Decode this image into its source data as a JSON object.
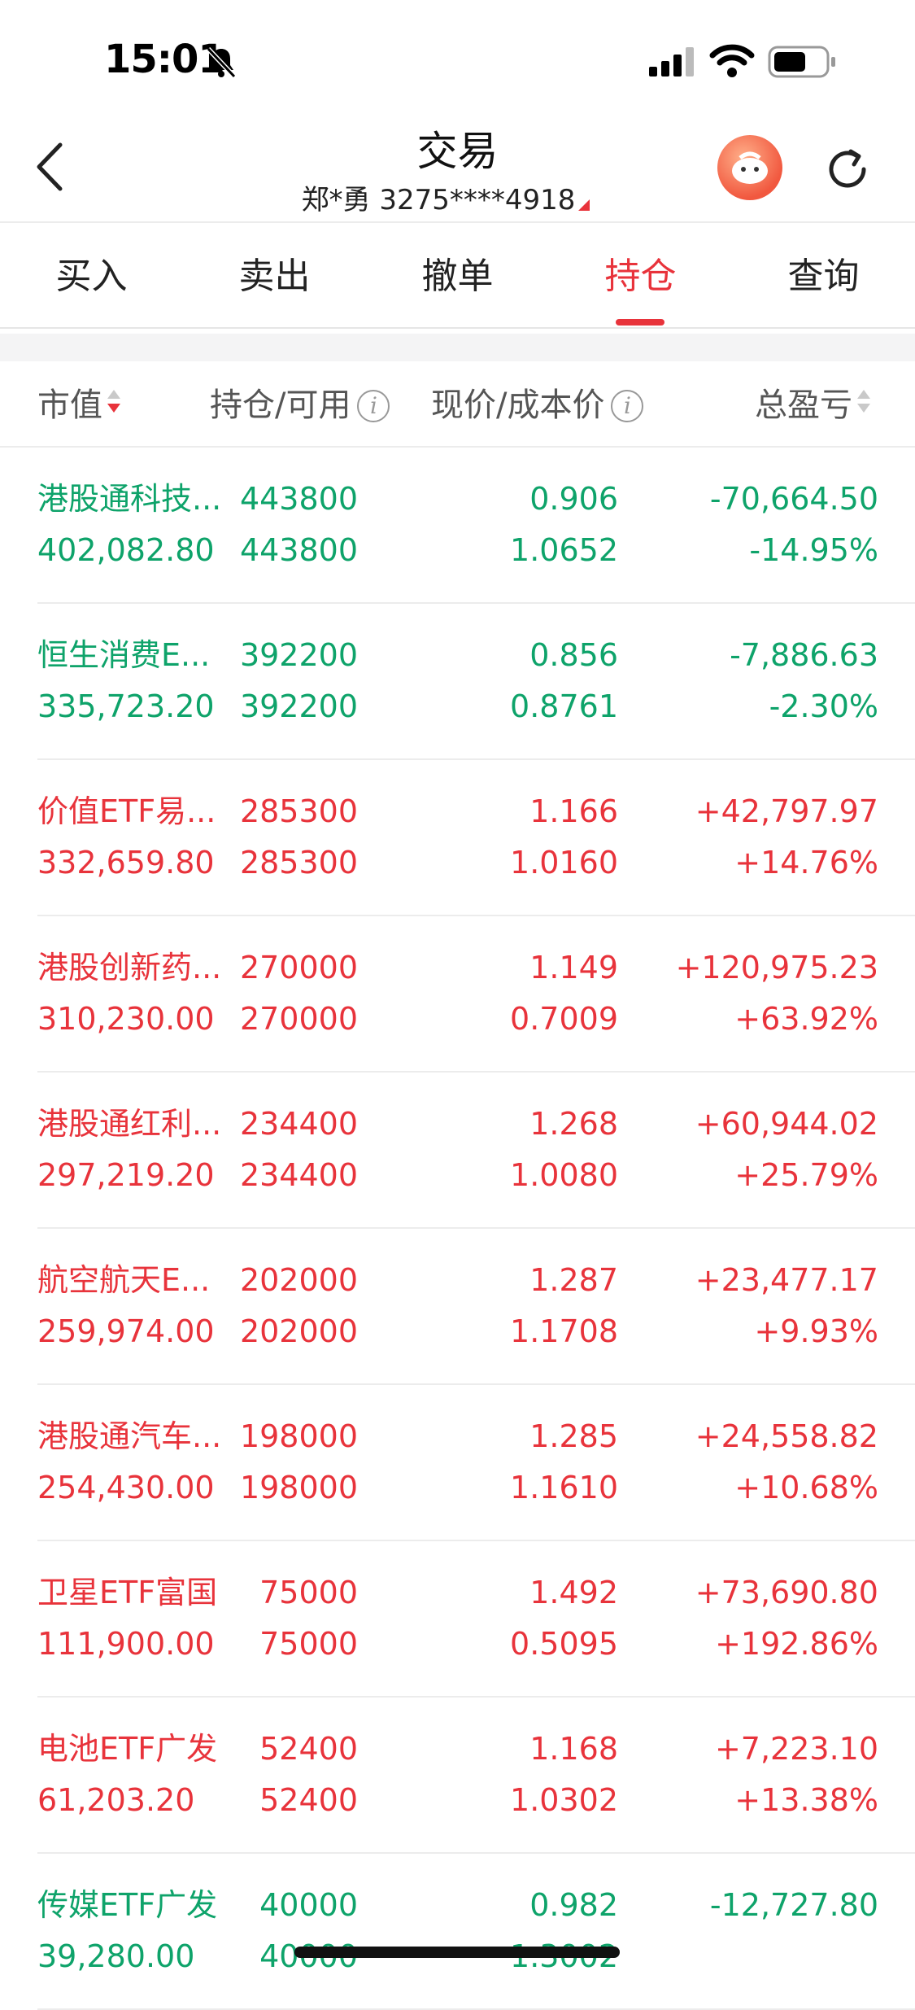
{
  "status_bar": {
    "time": "15:01"
  },
  "header": {
    "title": "交易",
    "account": "郑*勇 3275****4918"
  },
  "tabs": [
    {
      "label": "买入"
    },
    {
      "label": "卖出"
    },
    {
      "label": "撤单"
    },
    {
      "label": "持仓"
    },
    {
      "label": "查询"
    }
  ],
  "active_tab": "持仓",
  "columns": {
    "col1": "市值",
    "col2": "持仓/可用",
    "col3": "现价/成本价",
    "col4": "总盈亏"
  },
  "colors": {
    "up": "#e8333b",
    "down": "#0ea36a"
  },
  "holdings": [
    {
      "name": "港股通科技...",
      "market_value": "402,082.80",
      "position": "443800",
      "available": "443800",
      "price": "0.906",
      "cost": "1.0652",
      "pnl": "-70,664.50",
      "pnl_pct": "-14.95%",
      "trend": "dn"
    },
    {
      "name": "恒生消费E...",
      "market_value": "335,723.20",
      "position": "392200",
      "available": "392200",
      "price": "0.856",
      "cost": "0.8761",
      "pnl": "-7,886.63",
      "pnl_pct": "-2.30%",
      "trend": "dn"
    },
    {
      "name": "价值ETF易...",
      "market_value": "332,659.80",
      "position": "285300",
      "available": "285300",
      "price": "1.166",
      "cost": "1.0160",
      "pnl": "+42,797.97",
      "pnl_pct": "+14.76%",
      "trend": "up"
    },
    {
      "name": "港股创新药...",
      "market_value": "310,230.00",
      "position": "270000",
      "available": "270000",
      "price": "1.149",
      "cost": "0.7009",
      "pnl": "+120,975.23",
      "pnl_pct": "+63.92%",
      "trend": "up"
    },
    {
      "name": "港股通红利...",
      "market_value": "297,219.20",
      "position": "234400",
      "available": "234400",
      "price": "1.268",
      "cost": "1.0080",
      "pnl": "+60,944.02",
      "pnl_pct": "+25.79%",
      "trend": "up"
    },
    {
      "name": "航空航天E...",
      "market_value": "259,974.00",
      "position": "202000",
      "available": "202000",
      "price": "1.287",
      "cost": "1.1708",
      "pnl": "+23,477.17",
      "pnl_pct": "+9.93%",
      "trend": "up"
    },
    {
      "name": "港股通汽车...",
      "market_value": "254,430.00",
      "position": "198000",
      "available": "198000",
      "price": "1.285",
      "cost": "1.1610",
      "pnl": "+24,558.82",
      "pnl_pct": "+10.68%",
      "trend": "up"
    },
    {
      "name": "卫星ETF富国",
      "market_value": "111,900.00",
      "position": "75000",
      "available": "75000",
      "price": "1.492",
      "cost": "0.5095",
      "pnl": "+73,690.80",
      "pnl_pct": "+192.86%",
      "trend": "up"
    },
    {
      "name": "电池ETF广发",
      "market_value": "61,203.20",
      "position": "52400",
      "available": "52400",
      "price": "1.168",
      "cost": "1.0302",
      "pnl": "+7,223.10",
      "pnl_pct": "+13.38%",
      "trend": "up"
    },
    {
      "name": "传媒ETF广发",
      "market_value": "39,280.00",
      "position": "40000",
      "available": "40000",
      "price": "0.982",
      "cost": "1.3002",
      "pnl": "-12,727.80",
      "pnl_pct": "",
      "trend": "dn"
    }
  ]
}
